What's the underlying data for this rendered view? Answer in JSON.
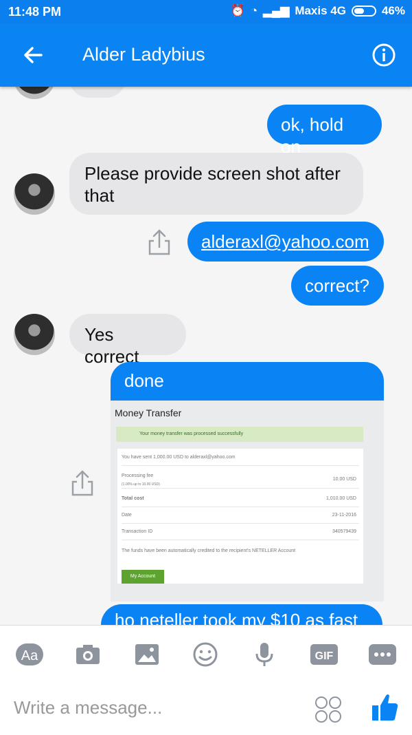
{
  "status": {
    "time": "11:48 PM",
    "carrier": "Maxis 4G",
    "battery": "46%"
  },
  "header": {
    "contact_name": "Alder Ladybius"
  },
  "messages": {
    "m1": "ok, hold on",
    "m2": "Please provide screen shot after that",
    "m3": "alderaxl@yahoo.com",
    "m4": "correct?",
    "m5": "Yes correct",
    "m6": "done",
    "m7_partial": "ho neteller took my $10 as fast"
  },
  "screenshot": {
    "title": "Money Transfer",
    "success": "Your money transfer was processed successfully",
    "sent": "You have sent 1,000.00 USD to alderaxl@yahoo.com",
    "fee_label": "Processing fee",
    "fee_sub": "(1.00% up to 10.00 USD)",
    "fee_value": "10.00 USD",
    "total_label": "Total cost",
    "total_value": "1,010.00 USD",
    "date_label": "Date",
    "date_value": "23-11-2016",
    "txn_label": "Transaction ID",
    "txn_value": "340579439",
    "note": "The funds have been automatically credited to the recipient's NETELLER Account",
    "button": "My Account"
  },
  "composer": {
    "aa_label": "Aa",
    "gif_label": "GIF",
    "placeholder": "Write a message..."
  },
  "colors": {
    "accent": "#0a84f4",
    "incoming_bubble": "#e6e6e9",
    "chat_bg": "#f5f5f6"
  }
}
